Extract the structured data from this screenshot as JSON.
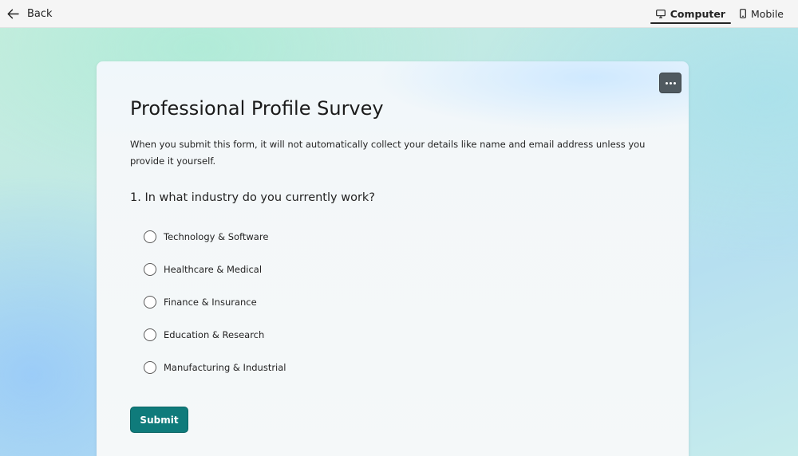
{
  "topbar": {
    "back_label": "Back",
    "views": [
      {
        "label": "Computer",
        "active": true
      },
      {
        "label": "Mobile",
        "active": false
      }
    ]
  },
  "form": {
    "title": "Professional Profile Survey",
    "description": "When you submit this form, it will not automatically collect your details like name and email address unless you provide it yourself.",
    "question": {
      "number": "1.",
      "text": "In what industry do you currently work?",
      "full": "1. In what industry do you currently work?",
      "options": [
        "Technology & Software",
        "Healthcare & Medical",
        "Finance & Insurance",
        "Education & Research",
        "Manufacturing & Industrial"
      ]
    },
    "submit_label": "Submit"
  },
  "icons": {
    "back": "arrow-left-icon",
    "computer": "desktop-icon",
    "mobile": "phone-icon",
    "more": "more-horizontal-icon"
  },
  "colors": {
    "accent": "#0f7b7b",
    "more_button": "#505a60",
    "text": "#242424"
  }
}
